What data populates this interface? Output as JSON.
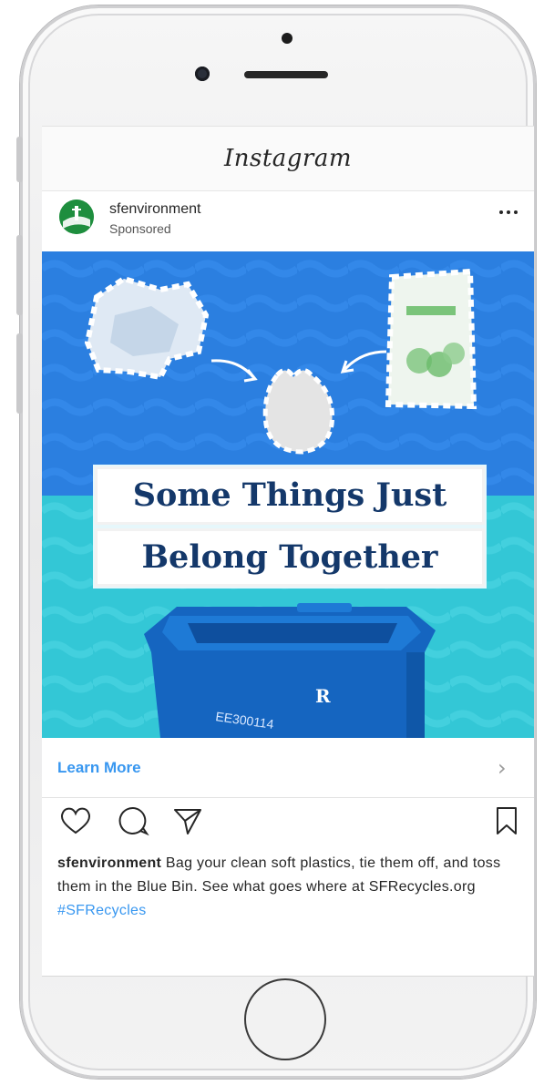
{
  "app": {
    "title": "Instagram"
  },
  "post": {
    "username": "sfenvironment",
    "sponsored_label": "Sponsored",
    "more_icon": "more-horizontal-icon",
    "headline_line1": "Some Things Just",
    "headline_line2": "Belong Together",
    "cta_label": "Learn More",
    "cta_icon": "chevron-right-icon",
    "caption_username": "sfenvironment",
    "caption_text": " Bag your clean soft plastics, tie them off, and toss them in the Blue Bin. See what goes where at SFRecycles.org ",
    "caption_hashtag": "#SFRecycles",
    "bin_label": "EE300114",
    "actions": [
      "heart-icon",
      "comment-icon",
      "share-icon",
      "bookmark-icon"
    ]
  },
  "colors": {
    "ad_top_blue": "#2b7fe0",
    "ad_bottom_teal": "#33c7d6",
    "headline_navy": "#14386a",
    "link_blue": "#3897f0",
    "bin_blue": "#1565c0"
  }
}
